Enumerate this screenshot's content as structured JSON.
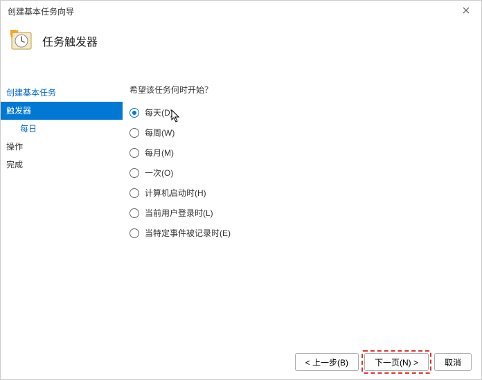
{
  "window": {
    "title": "创建基本任务向导"
  },
  "header": {
    "title": "任务触发器"
  },
  "sidebar": {
    "items": [
      {
        "label": "创建基本任务"
      },
      {
        "label": "触发器"
      },
      {
        "label": "每日"
      },
      {
        "label": "操作"
      },
      {
        "label": "完成"
      }
    ]
  },
  "main": {
    "prompt": "希望该任务何时开始？",
    "options": [
      {
        "label": "每天(D)",
        "checked": true
      },
      {
        "label": "每周(W)",
        "checked": false
      },
      {
        "label": "每月(M)",
        "checked": false
      },
      {
        "label": "一次(O)",
        "checked": false
      },
      {
        "label": "计算机启动时(H)",
        "checked": false
      },
      {
        "label": "当前用户登录时(L)",
        "checked": false
      },
      {
        "label": "当特定事件被记录时(E)",
        "checked": false
      }
    ]
  },
  "footer": {
    "back": "< 上一步(B)",
    "next": "下一页(N) >",
    "cancel": "取消"
  },
  "annotation": {
    "highlight_target": "next-button"
  }
}
